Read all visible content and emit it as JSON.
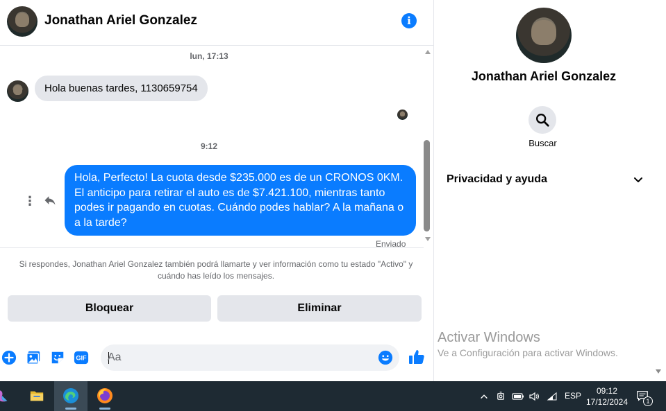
{
  "header": {
    "contact_name": "Jonathan Ariel Gonzalez",
    "info_icon": "info-icon"
  },
  "messages": {
    "timestamp_1": "lun, 17:13",
    "incoming_text": "Hola buenas tardes, 1130659754",
    "timestamp_2": "9:12",
    "outgoing_text": "Hola, Perfecto! La cuota desde $235.000 es de un CRONOS 0KM. El anticipo para retirar el auto es de $7.421.100, mientras tanto podes ir pagando en cuotas. Cuándo podes hablar? A la mañana o a la tarde?",
    "status": "Enviado"
  },
  "notice": "Si respondes, Jonathan Ariel Gonzalez también podrá llamarte y ver información como tu estado \"Activo\" y cuándo has leído los mensajes.",
  "actions": {
    "block_label": "Bloquear",
    "delete_label": "Eliminar"
  },
  "composer": {
    "placeholder": "Aa",
    "gif_label": "GIF"
  },
  "side": {
    "name": "Jonathan Ariel Gonzalez",
    "search_label": "Buscar",
    "privacy_label": "Privacidad y ayuda"
  },
  "watermark": {
    "line1": "Activar Windows",
    "line2": "Ve a Configuración para activar Windows."
  },
  "taskbar": {
    "language": "ESP",
    "time": "09:12",
    "date": "17/12/2024",
    "notification_count": "1"
  },
  "colors": {
    "accent": "#0a7cff",
    "bubble_in": "#e4e6eb",
    "taskbar": "#1e2a33"
  }
}
